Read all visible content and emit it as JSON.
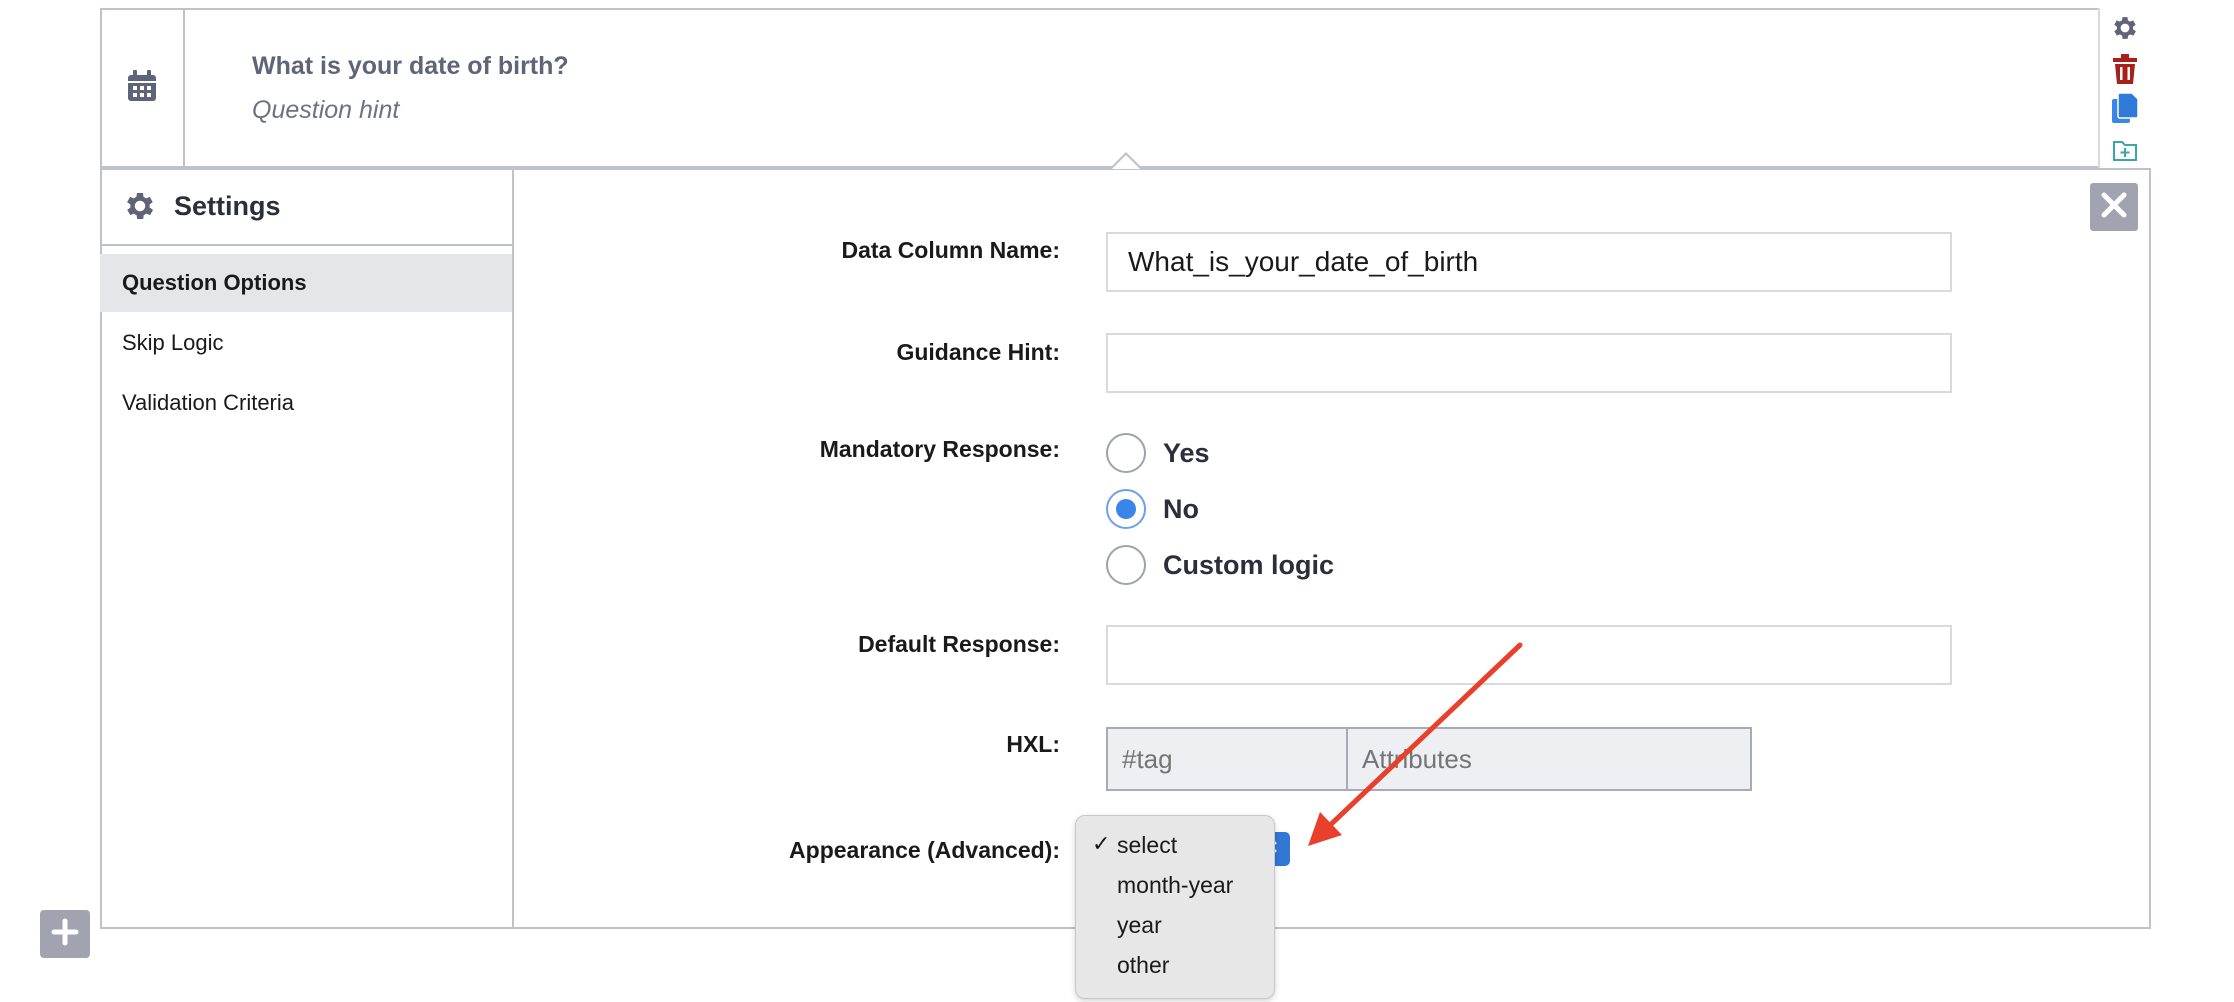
{
  "question": {
    "title": "What is your date of birth?",
    "hint": "Question hint"
  },
  "toolbar": {
    "icons": [
      "gear-icon",
      "trash-icon",
      "copy-icon",
      "add-to-library-icon"
    ]
  },
  "settings": {
    "title": "Settings",
    "nav": [
      {
        "label": "Question Options",
        "active": true
      },
      {
        "label": "Skip Logic",
        "active": false
      },
      {
        "label": "Validation Criteria",
        "active": false
      }
    ]
  },
  "form": {
    "data_column_name": {
      "label": "Data Column Name:",
      "value": "What_is_your_date_of_birth"
    },
    "guidance_hint": {
      "label": "Guidance Hint:",
      "value": ""
    },
    "mandatory": {
      "label": "Mandatory Response:",
      "options": [
        "Yes",
        "No",
        "Custom logic"
      ],
      "selected": "No"
    },
    "default_response": {
      "label": "Default Response:",
      "value": ""
    },
    "hxl": {
      "label": "HXL:",
      "tag_placeholder": "#tag",
      "attributes_placeholder": "Attributes"
    },
    "appearance": {
      "label": "Appearance (Advanced):",
      "selected": "select",
      "options": [
        "select",
        "month-year",
        "year",
        "other"
      ]
    }
  },
  "colors": {
    "accent": "#3a86e8",
    "border": "#bfc2cc",
    "delete": "#a8201a",
    "annotation_arrow": "#e8402a"
  }
}
